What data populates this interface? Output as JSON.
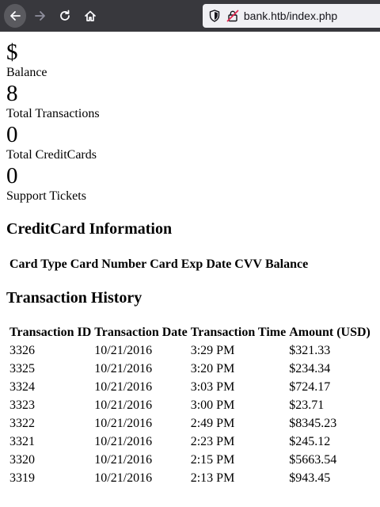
{
  "browser": {
    "url": "bank.htb/index.php"
  },
  "stats": [
    {
      "value": "$",
      "label": "Balance"
    },
    {
      "value": "8",
      "label": "Total Transactions"
    },
    {
      "value": "0",
      "label": "Total CreditCards"
    },
    {
      "value": "0",
      "label": "Support Tickets"
    }
  ],
  "creditcards": {
    "heading": "CreditCard Information",
    "columns": [
      "Card Type",
      "Card Number",
      "Card Exp Date",
      "CVV",
      "Balance"
    ]
  },
  "transactions": {
    "heading": "Transaction History",
    "columns": [
      "Transaction ID",
      "Transaction Date",
      "Transaction Time",
      "Amount (USD)"
    ],
    "rows": [
      [
        "3326",
        "10/21/2016",
        "3:29 PM",
        "$321.33"
      ],
      [
        "3325",
        "10/21/2016",
        "3:20 PM",
        "$234.34"
      ],
      [
        "3324",
        "10/21/2016",
        "3:03 PM",
        "$724.17"
      ],
      [
        "3323",
        "10/21/2016",
        "3:00 PM",
        "$23.71"
      ],
      [
        "3322",
        "10/21/2016",
        "2:49 PM",
        "$8345.23"
      ],
      [
        "3321",
        "10/21/2016",
        "2:23 PM",
        "$245.12"
      ],
      [
        "3320",
        "10/21/2016",
        "2:15 PM",
        "$5663.54"
      ],
      [
        "3319",
        "10/21/2016",
        "2:13 PM",
        "$943.45"
      ]
    ]
  }
}
